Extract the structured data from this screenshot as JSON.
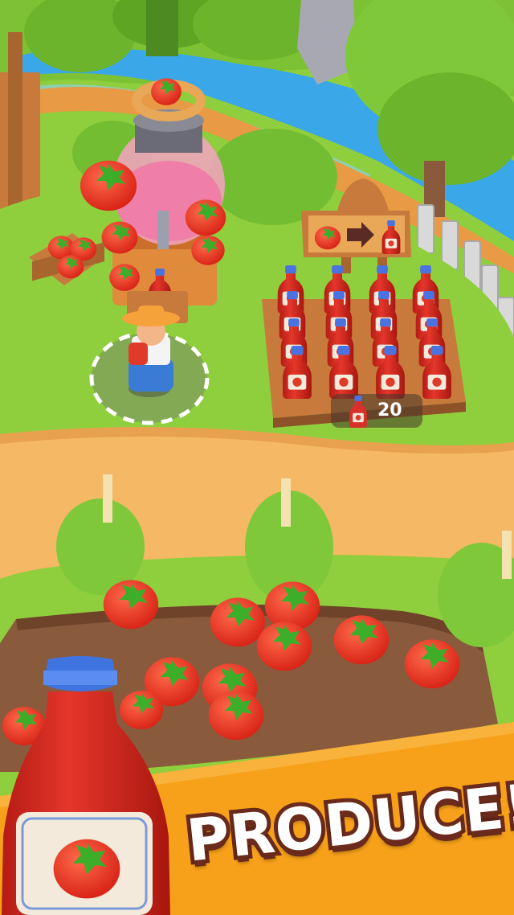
{
  "hud": {
    "ketchup_count": "20",
    "ketchup_icon": "ketchup-bottle-icon"
  },
  "sign": {
    "input_icon": "tomato-icon",
    "arrow_icon": "arrow-right-icon",
    "output_icon": "ketchup-bottle-icon"
  },
  "banner": {
    "text": "PRODUCE!"
  },
  "colors": {
    "grass": "#8fce3c",
    "path": "#f5b865",
    "soil": "#8a5a3c",
    "water": "#3aa7e8",
    "banner": "#f7a11a",
    "tomato": "#e8382a",
    "ketchup_red": "#c9261d",
    "cap_blue": "#3f74e0"
  }
}
